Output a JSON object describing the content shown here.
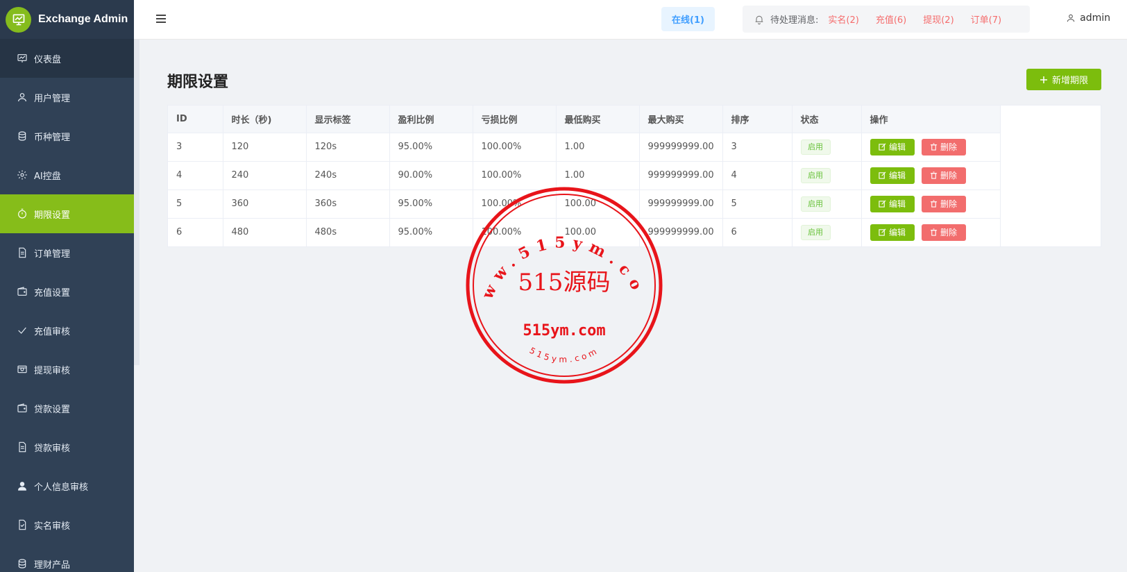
{
  "brand": {
    "title": "Exchange Admin"
  },
  "sidebar": {
    "items": [
      {
        "label": "仪表盘",
        "icon": "chart-icon"
      },
      {
        "label": "用户管理",
        "icon": "user-icon"
      },
      {
        "label": "币种管理",
        "icon": "database-icon"
      },
      {
        "label": "AI控盘",
        "icon": "gear-icon"
      },
      {
        "label": "期限设置",
        "icon": "timer-icon"
      },
      {
        "label": "订单管理",
        "icon": "document-icon"
      },
      {
        "label": "充值设置",
        "icon": "wallet-icon"
      },
      {
        "label": "充值审核",
        "icon": "check-icon"
      },
      {
        "label": "提现审核",
        "icon": "money-icon"
      },
      {
        "label": "贷款设置",
        "icon": "wallet-icon"
      },
      {
        "label": "贷款审核",
        "icon": "document-icon"
      },
      {
        "label": "个人信息审核",
        "icon": "user-fill-icon"
      },
      {
        "label": "实名审核",
        "icon": "doc-check-icon"
      },
      {
        "label": "理财产品",
        "icon": "database-icon"
      }
    ]
  },
  "header": {
    "online": "在线(1)",
    "pending_label": "待处理消息:",
    "pending_links": [
      "实名(2)",
      "充值(6)",
      "提现(2)",
      "订单(7)"
    ],
    "username": "admin"
  },
  "main": {
    "title": "期限设置",
    "add_button": "新增期限",
    "columns": [
      "ID",
      "时长（秒)",
      "显示标签",
      "盈利比例",
      "亏损比例",
      "最低购买",
      "最大购买",
      "排序",
      "状态",
      "操作"
    ],
    "rows": [
      [
        "3",
        "120",
        "120s",
        "95.00%",
        "100.00%",
        "1.00",
        "999999999.00",
        "3",
        "启用"
      ],
      [
        "4",
        "240",
        "240s",
        "90.00%",
        "100.00%",
        "1.00",
        "999999999.00",
        "4",
        "启用"
      ],
      [
        "5",
        "360",
        "360s",
        "95.00%",
        "100.00%",
        "100.00",
        "999999999.00",
        "5",
        "启用"
      ],
      [
        "6",
        "480",
        "480s",
        "95.00%",
        "100.00%",
        "100.00",
        "999999999.00",
        "6",
        "启用"
      ]
    ],
    "edit_label": "编辑",
    "delete_label": "删除"
  },
  "watermark": {
    "outer_text": "www.515ym.com",
    "center_text": "515源码",
    "domain_text": "515ym.com",
    "bottom_text": "515ym.com"
  },
  "colors": {
    "accent": "#86bd1a",
    "sidebar": "#304156",
    "danger": "#f26d6d",
    "stamp": "#e8141a"
  }
}
